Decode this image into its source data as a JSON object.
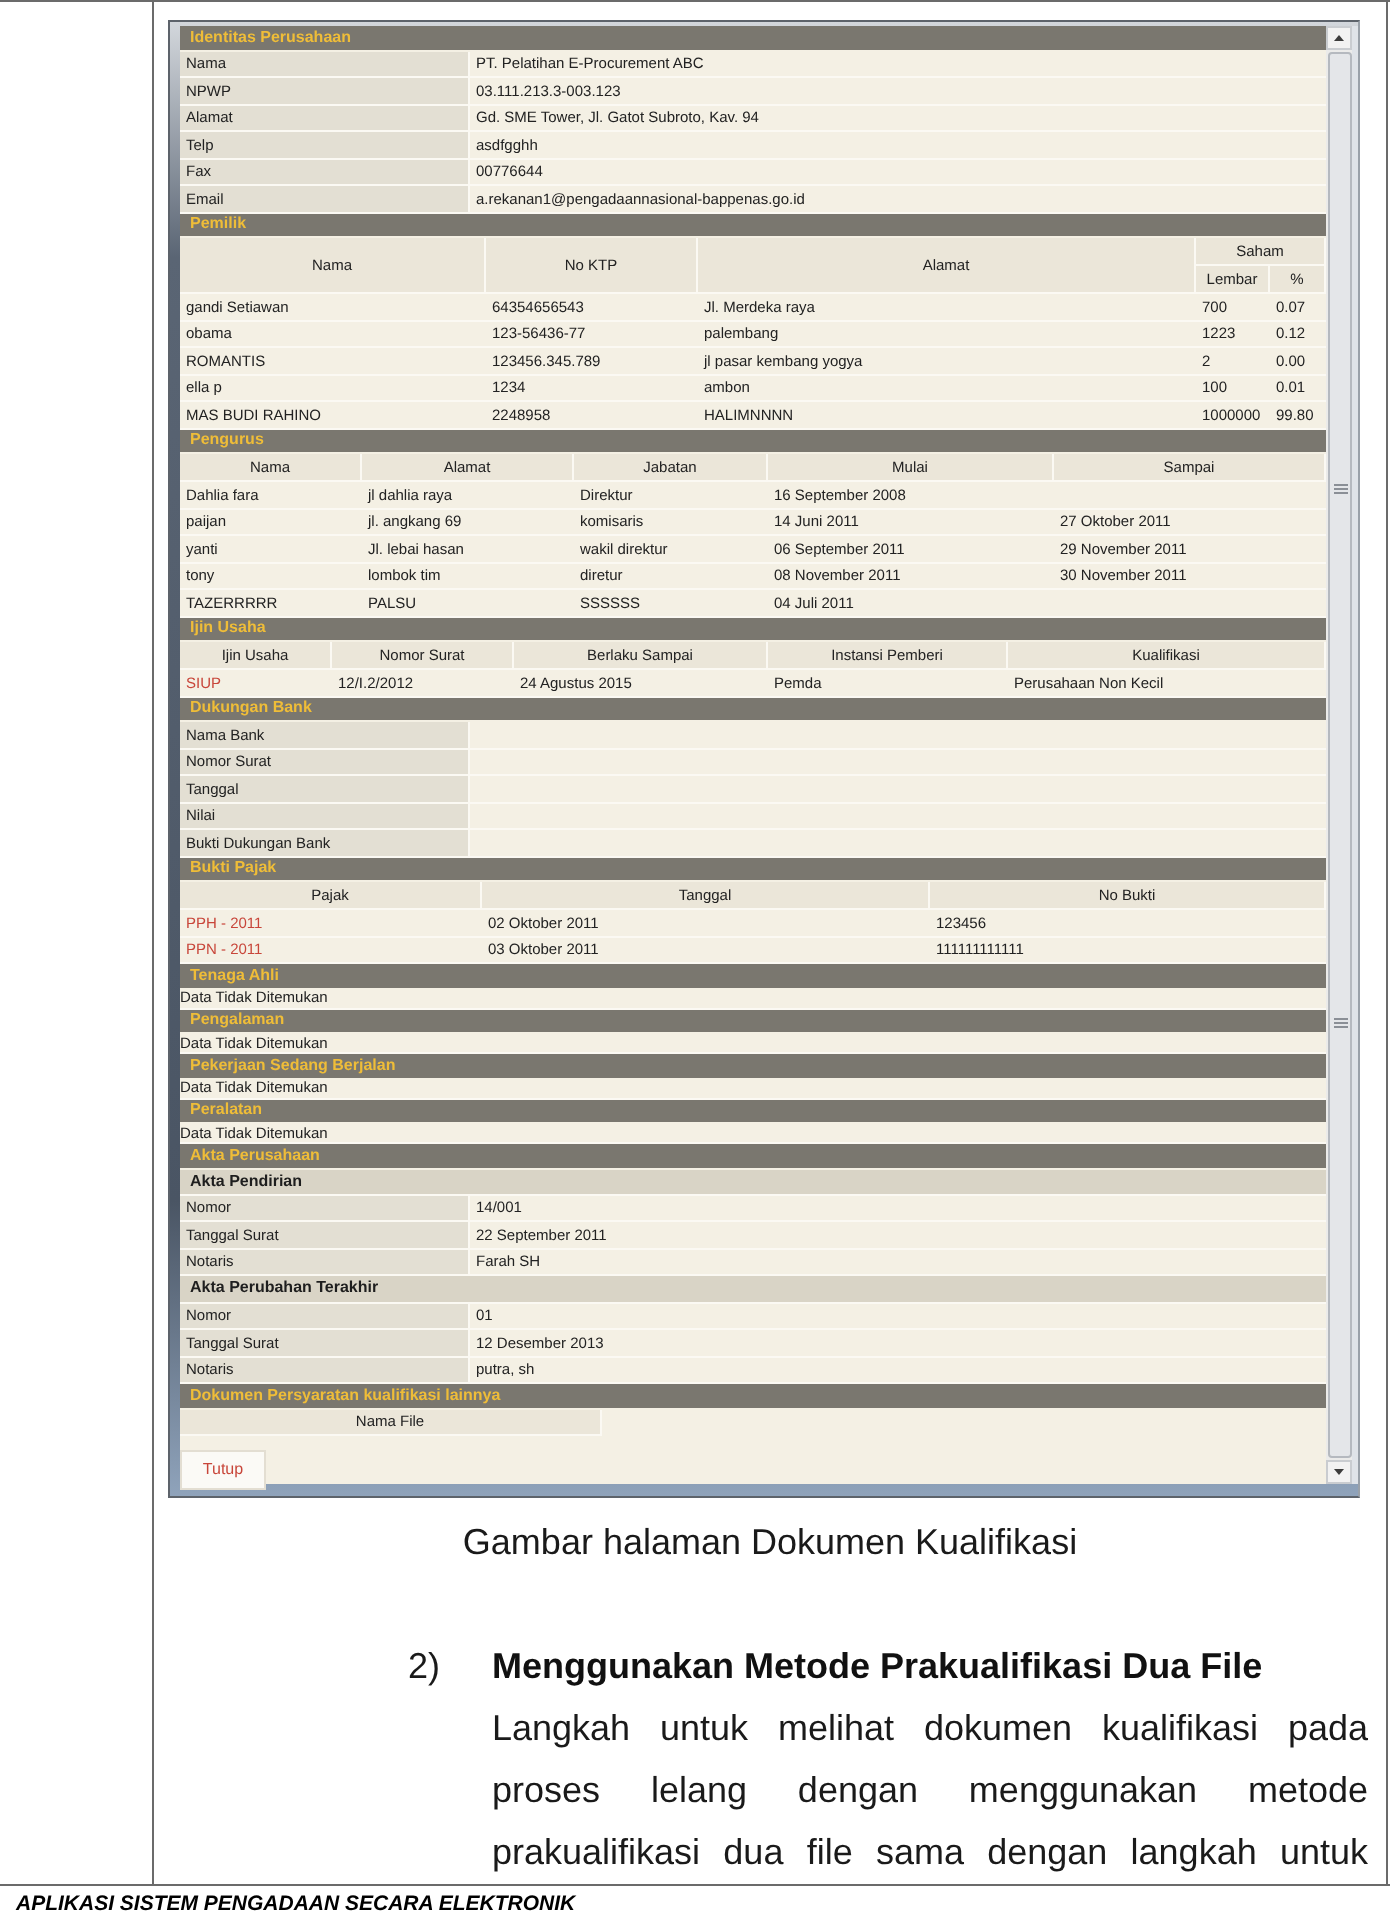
{
  "window": {
    "sections": [
      {
        "kind": "fields",
        "title": "Identitas Perusahaan",
        "fields": [
          {
            "label": "Nama",
            "value": "PT. Pelatihan E-Procurement ABC"
          },
          {
            "label": "NPWP",
            "value": "03.111.213.3-003.123"
          },
          {
            "label": "Alamat",
            "value": "Gd. SME Tower, Jl. Gatot Subroto, Kav. 94"
          },
          {
            "label": "Telp",
            "value": "asdfgghh"
          },
          {
            "label": "Fax",
            "value": "00776644"
          },
          {
            "label": "Email",
            "value": "a.rekanan1@pengadaannasional-bappenas.go.id"
          }
        ]
      },
      {
        "kind": "table",
        "title": "Pemilik",
        "columns": [
          {
            "label": "Nama"
          },
          {
            "label": "No KTP"
          },
          {
            "label": "Alamat"
          },
          {
            "label": "Saham",
            "children": [
              {
                "label": "Lembar"
              },
              {
                "label": "%"
              }
            ]
          }
        ],
        "rows": [
          [
            "gandi Setiawan",
            "64354656543",
            "Jl. Merdeka raya",
            "700",
            "0.07"
          ],
          [
            "obama",
            "123-56436-77",
            "palembang",
            "1223",
            "0.12"
          ],
          [
            "ROMANTIS",
            "123456.345.789",
            "jl pasar kembang yogya",
            "2",
            "0.00"
          ],
          [
            "ella p",
            "1234",
            "ambon",
            "100",
            "0.01"
          ],
          [
            "MAS BUDI RAHINO",
            "2248958",
            "HALIMNNNN",
            "1000000",
            "99.80"
          ]
        ]
      },
      {
        "kind": "table",
        "title": "Pengurus",
        "columns": [
          {
            "label": "Nama"
          },
          {
            "label": "Alamat"
          },
          {
            "label": "Jabatan"
          },
          {
            "label": "Mulai"
          },
          {
            "label": "Sampai"
          }
        ],
        "rows": [
          [
            "Dahlia fara",
            "jl dahlia raya",
            "Direktur",
            "16 September 2008"
          ],
          [
            "paijan",
            "jl. angkang 69",
            "komisaris",
            "14 Juni 2011",
            "27 Oktober 2011"
          ],
          [
            "yanti",
            "Jl. lebai hasan",
            "wakil direktur",
            "06 September 2011",
            "29 November 2011"
          ],
          [
            "tony",
            "lombok tim",
            "diretur",
            "08 November 2011",
            "30 November 2011"
          ],
          [
            "TAZERRRRR",
            "PALSU",
            "SSSSSS",
            "04 Juli 2011"
          ]
        ]
      },
      {
        "kind": "table",
        "title": "Ijin Usaha",
        "columns": [
          {
            "label": "Ijin Usaha",
            "link": true
          },
          {
            "label": "Nomor Surat"
          },
          {
            "label": "Berlaku Sampai"
          },
          {
            "label": "Instansi Pemberi"
          },
          {
            "label": "Kualifikasi"
          }
        ],
        "rows": [
          [
            "SIUP",
            "12/I.2/2012",
            "24 Agustus 2015",
            "Pemda",
            "Perusahaan Non Kecil"
          ]
        ]
      },
      {
        "kind": "fields",
        "title": "Dukungan Bank",
        "fields": [
          {
            "label": "Nama Bank"
          },
          {
            "label": "Nomor Surat"
          },
          {
            "label": "Tanggal"
          },
          {
            "label": "Nilai"
          },
          {
            "label": "Bukti Dukungan Bank"
          }
        ]
      },
      {
        "kind": "table",
        "title": "Bukti Pajak",
        "columns": [
          {
            "label": "Pajak",
            "link": true
          },
          {
            "label": "Tanggal"
          },
          {
            "label": "No Bukti"
          }
        ],
        "rows": [
          [
            "PPH - 2011",
            "02 Oktober 2011",
            "123456"
          ],
          [
            "PPN - 2011",
            "03 Oktober 2011",
            "111111111111"
          ]
        ]
      },
      {
        "kind": "empty",
        "title": "Tenaga Ahli",
        "message": "Data Tidak Ditemukan"
      },
      {
        "kind": "empty",
        "title": "Pengalaman",
        "message": "Data Tidak Ditemukan"
      },
      {
        "kind": "empty",
        "title": "Pekerjaan Sedang Berjalan",
        "message": "Data Tidak Ditemukan"
      },
      {
        "kind": "empty",
        "title": "Peralatan",
        "message": "Data Tidak Ditemukan"
      },
      {
        "kind": "groups",
        "title": "Akta Perusahaan",
        "groups": [
          {
            "title": "Akta Pendirian",
            "fields": [
              {
                "label": "Nomor",
                "value": "14/001"
              },
              {
                "label": "Tanggal Surat",
                "value": "22 September 2011"
              },
              {
                "label": "Notaris",
                "value": "Farah SH"
              }
            ]
          },
          {
            "title": "Akta Perubahan Terakhir",
            "fields": [
              {
                "label": "Nomor",
                "value": "01"
              },
              {
                "label": "Tanggal Surat",
                "value": "12 Desember 2013"
              },
              {
                "label": "Notaris",
                "value": "putra, sh"
              }
            ]
          }
        ]
      },
      {
        "kind": "files",
        "title": "Dokumen Persyaratan kualifikasi lainnya",
        "column": "Nama File"
      }
    ],
    "close_button": "Tutup"
  },
  "caption": "Gambar halaman Dokumen Kualifikasi",
  "step": {
    "number": "2)",
    "title": "Menggunakan Metode Prakualifikasi Dua File",
    "text": "Langkah untuk melihat dokumen kualifikasi pada proses lelang dengan menggunakan metode prakualifikasi dua file sama dengan langkah untuk"
  },
  "footer": "APLIKASI SISTEM PENGADAAN SECARA ELEKTRONIK"
}
